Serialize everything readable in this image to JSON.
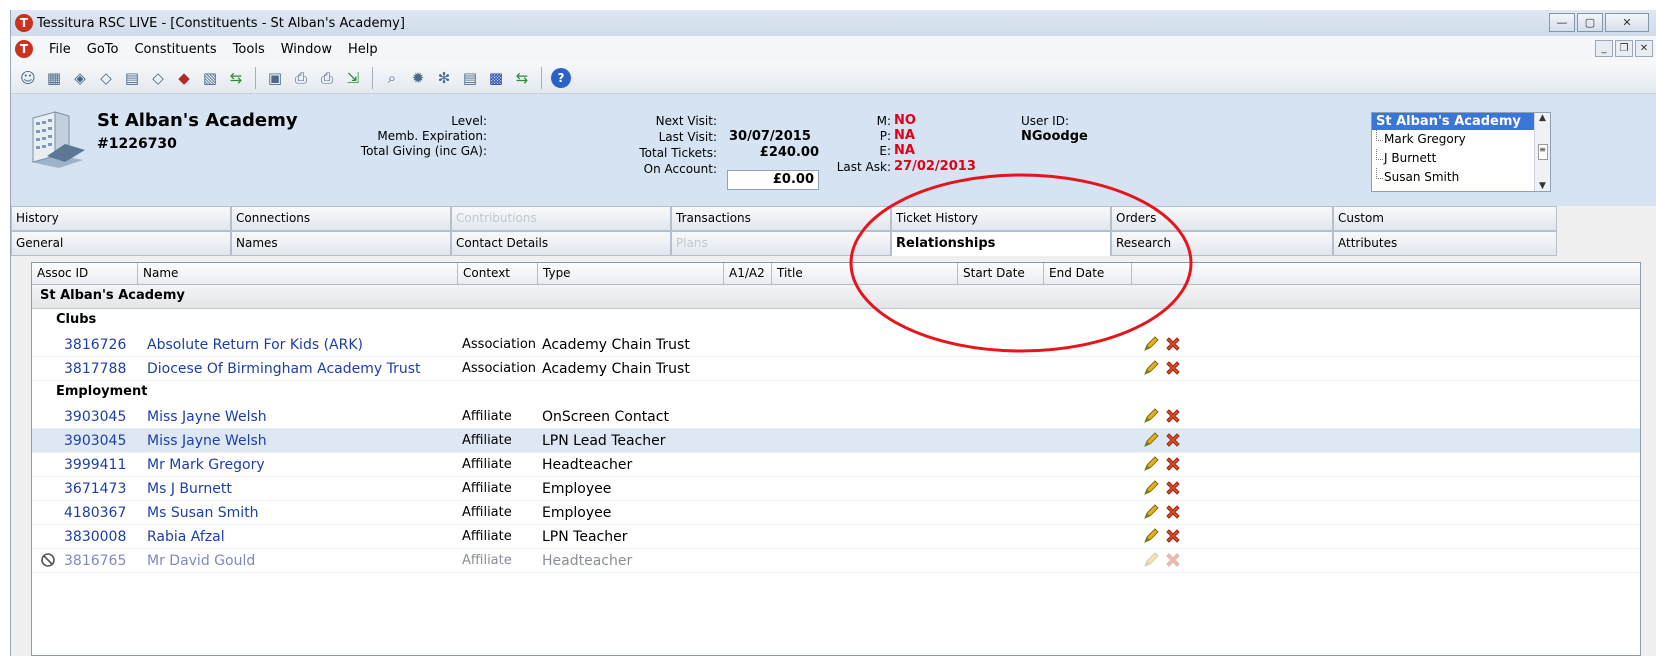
{
  "window": {
    "title": "Tessitura RSC LIVE - [Constituents - St Alban's Academy]",
    "logo_letter": "T",
    "controls": {
      "minimize": "—",
      "maximize": "▢",
      "close": "✕"
    }
  },
  "menu": {
    "items": [
      "File",
      "GoTo",
      "Constituents",
      "Tools",
      "Window",
      "Help"
    ],
    "mdi_controls": {
      "minimize": "_",
      "restore": "❐",
      "close": "✕"
    }
  },
  "toolbar": {
    "icons": [
      "person-icon",
      "chart-icon",
      "ticket-icon",
      "ticket2-icon",
      "notes-icon",
      "ticket3-icon",
      "gift-icon",
      "edit-icon",
      "arrows-icon",
      "save-icon",
      "print-icon",
      "print2-icon",
      "export-icon",
      "search-icon",
      "gear-icon",
      "gear2-icon",
      "notes2-icon",
      "grid-icon",
      "arrows2-icon",
      "help-icon"
    ],
    "glyphs": [
      "☺",
      "▦",
      "◈",
      "◇",
      "▤",
      "◇",
      "◆",
      "▧",
      "⇆",
      "▣",
      "⎙",
      "⎙",
      "⇲",
      "⌕",
      "✹",
      "✻",
      "▤",
      "▩",
      "⇆",
      "?"
    ]
  },
  "header": {
    "name": "St Alban's Academy",
    "id": "#1226730",
    "labels": {
      "level": "Level:",
      "memb_expiration": "Memb. Expiration:",
      "total_giving": "Total Giving (inc GA):",
      "next_visit": "Next Visit:",
      "last_visit": "Last Visit:",
      "total_tickets": "Total Tickets:",
      "on_account": "On Account:",
      "m": "M:",
      "p": "P:",
      "e": "E:",
      "last_ask": "Last Ask:",
      "user_id": "User ID:"
    },
    "values": {
      "last_visit": "30/07/2015",
      "total_tickets": "£240.00",
      "on_account": "£0.00",
      "m": "NO",
      "p": "NA",
      "e": "NA",
      "last_ask": "27/02/2013",
      "user_id": "NGoodge"
    },
    "associations": {
      "selected": "St Alban's Academy",
      "items": [
        "Mark Gregory",
        "J Burnett",
        "Susan Smith"
      ]
    }
  },
  "tabs": {
    "row1": [
      "History",
      "Connections",
      "Contributions",
      "Transactions",
      "Ticket History",
      "Orders",
      "Custom"
    ],
    "row2": [
      "General",
      "Names",
      "Contact Details",
      "Plans",
      "Relationships",
      "Research",
      "Attributes"
    ],
    "active": "Relationships"
  },
  "grid": {
    "columns": [
      "Assoc ID",
      "Name",
      "Context",
      "Type",
      "A1/A2",
      "Title",
      "Start Date",
      "End Date"
    ],
    "group": "St Alban's Academy",
    "subgroups": [
      "Clubs",
      "Employment"
    ],
    "rows": [
      {
        "id": "3816726",
        "name": "Absolute Return For Kids (ARK)",
        "context": "Association",
        "type": "Academy Chain Trust"
      },
      {
        "id": "3817788",
        "name": "Diocese Of Birmingham Academy Trust",
        "context": "Association",
        "type": "Academy Chain Trust"
      },
      {
        "id": "3903045",
        "name": "Miss Jayne Welsh",
        "context": "Affiliate",
        "type": "OnScreen Contact"
      },
      {
        "id": "3903045",
        "name": "Miss Jayne Welsh",
        "context": "Affiliate",
        "type": "LPN Lead Teacher"
      },
      {
        "id": "3999411",
        "name": "Mr Mark Gregory",
        "context": "Affiliate",
        "type": "Headteacher"
      },
      {
        "id": "3671473",
        "name": "Ms J Burnett",
        "context": "Affiliate",
        "type": "Employee"
      },
      {
        "id": "4180367",
        "name": "Ms Susan Smith",
        "context": "Affiliate",
        "type": "Employee"
      },
      {
        "id": "3830008",
        "name": "Rabia Afzal",
        "context": "Affiliate",
        "type": "LPN Teacher"
      },
      {
        "id": "3816765",
        "name": "Mr David Gould",
        "context": "Affiliate",
        "type": "Headteacher"
      }
    ]
  },
  "colors": {
    "header_bg": "#d5e3f2",
    "link": "#1c3fa6",
    "alert_red": "#e0001a",
    "annotation_red": "#e8141c",
    "selection": "#3a76d8"
  }
}
